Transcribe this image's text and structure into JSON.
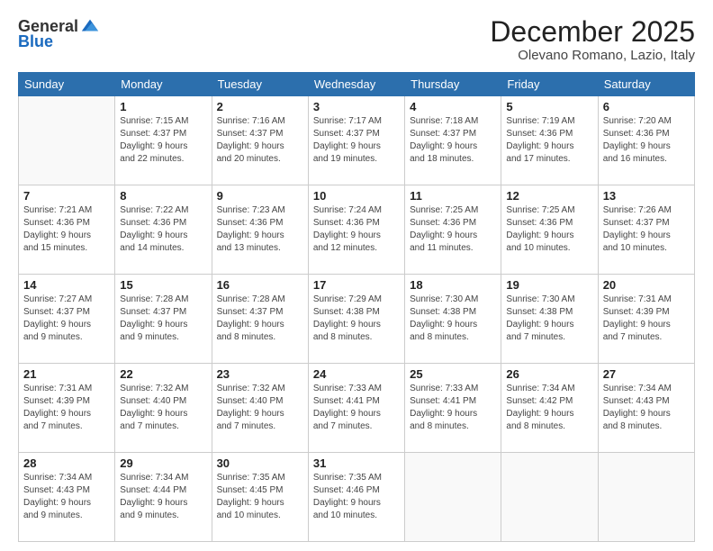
{
  "logo": {
    "general": "General",
    "blue": "Blue"
  },
  "title": {
    "month": "December 2025",
    "location": "Olevano Romano, Lazio, Italy"
  },
  "headers": [
    "Sunday",
    "Monday",
    "Tuesday",
    "Wednesday",
    "Thursday",
    "Friday",
    "Saturday"
  ],
  "weeks": [
    [
      {
        "day": "",
        "info": ""
      },
      {
        "day": "1",
        "info": "Sunrise: 7:15 AM\nSunset: 4:37 PM\nDaylight: 9 hours\nand 22 minutes."
      },
      {
        "day": "2",
        "info": "Sunrise: 7:16 AM\nSunset: 4:37 PM\nDaylight: 9 hours\nand 20 minutes."
      },
      {
        "day": "3",
        "info": "Sunrise: 7:17 AM\nSunset: 4:37 PM\nDaylight: 9 hours\nand 19 minutes."
      },
      {
        "day": "4",
        "info": "Sunrise: 7:18 AM\nSunset: 4:37 PM\nDaylight: 9 hours\nand 18 minutes."
      },
      {
        "day": "5",
        "info": "Sunrise: 7:19 AM\nSunset: 4:36 PM\nDaylight: 9 hours\nand 17 minutes."
      },
      {
        "day": "6",
        "info": "Sunrise: 7:20 AM\nSunset: 4:36 PM\nDaylight: 9 hours\nand 16 minutes."
      }
    ],
    [
      {
        "day": "7",
        "info": "Sunrise: 7:21 AM\nSunset: 4:36 PM\nDaylight: 9 hours\nand 15 minutes."
      },
      {
        "day": "8",
        "info": "Sunrise: 7:22 AM\nSunset: 4:36 PM\nDaylight: 9 hours\nand 14 minutes."
      },
      {
        "day": "9",
        "info": "Sunrise: 7:23 AM\nSunset: 4:36 PM\nDaylight: 9 hours\nand 13 minutes."
      },
      {
        "day": "10",
        "info": "Sunrise: 7:24 AM\nSunset: 4:36 PM\nDaylight: 9 hours\nand 12 minutes."
      },
      {
        "day": "11",
        "info": "Sunrise: 7:25 AM\nSunset: 4:36 PM\nDaylight: 9 hours\nand 11 minutes."
      },
      {
        "day": "12",
        "info": "Sunrise: 7:25 AM\nSunset: 4:36 PM\nDaylight: 9 hours\nand 10 minutes."
      },
      {
        "day": "13",
        "info": "Sunrise: 7:26 AM\nSunset: 4:37 PM\nDaylight: 9 hours\nand 10 minutes."
      }
    ],
    [
      {
        "day": "14",
        "info": "Sunrise: 7:27 AM\nSunset: 4:37 PM\nDaylight: 9 hours\nand 9 minutes."
      },
      {
        "day": "15",
        "info": "Sunrise: 7:28 AM\nSunset: 4:37 PM\nDaylight: 9 hours\nand 9 minutes."
      },
      {
        "day": "16",
        "info": "Sunrise: 7:28 AM\nSunset: 4:37 PM\nDaylight: 9 hours\nand 8 minutes."
      },
      {
        "day": "17",
        "info": "Sunrise: 7:29 AM\nSunset: 4:38 PM\nDaylight: 9 hours\nand 8 minutes."
      },
      {
        "day": "18",
        "info": "Sunrise: 7:30 AM\nSunset: 4:38 PM\nDaylight: 9 hours\nand 8 minutes."
      },
      {
        "day": "19",
        "info": "Sunrise: 7:30 AM\nSunset: 4:38 PM\nDaylight: 9 hours\nand 7 minutes."
      },
      {
        "day": "20",
        "info": "Sunrise: 7:31 AM\nSunset: 4:39 PM\nDaylight: 9 hours\nand 7 minutes."
      }
    ],
    [
      {
        "day": "21",
        "info": "Sunrise: 7:31 AM\nSunset: 4:39 PM\nDaylight: 9 hours\nand 7 minutes."
      },
      {
        "day": "22",
        "info": "Sunrise: 7:32 AM\nSunset: 4:40 PM\nDaylight: 9 hours\nand 7 minutes."
      },
      {
        "day": "23",
        "info": "Sunrise: 7:32 AM\nSunset: 4:40 PM\nDaylight: 9 hours\nand 7 minutes."
      },
      {
        "day": "24",
        "info": "Sunrise: 7:33 AM\nSunset: 4:41 PM\nDaylight: 9 hours\nand 7 minutes."
      },
      {
        "day": "25",
        "info": "Sunrise: 7:33 AM\nSunset: 4:41 PM\nDaylight: 9 hours\nand 8 minutes."
      },
      {
        "day": "26",
        "info": "Sunrise: 7:34 AM\nSunset: 4:42 PM\nDaylight: 9 hours\nand 8 minutes."
      },
      {
        "day": "27",
        "info": "Sunrise: 7:34 AM\nSunset: 4:43 PM\nDaylight: 9 hours\nand 8 minutes."
      }
    ],
    [
      {
        "day": "28",
        "info": "Sunrise: 7:34 AM\nSunset: 4:43 PM\nDaylight: 9 hours\nand 9 minutes."
      },
      {
        "day": "29",
        "info": "Sunrise: 7:34 AM\nSunset: 4:44 PM\nDaylight: 9 hours\nand 9 minutes."
      },
      {
        "day": "30",
        "info": "Sunrise: 7:35 AM\nSunset: 4:45 PM\nDaylight: 9 hours\nand 10 minutes."
      },
      {
        "day": "31",
        "info": "Sunrise: 7:35 AM\nSunset: 4:46 PM\nDaylight: 9 hours\nand 10 minutes."
      },
      {
        "day": "",
        "info": ""
      },
      {
        "day": "",
        "info": ""
      },
      {
        "day": "",
        "info": ""
      }
    ]
  ]
}
